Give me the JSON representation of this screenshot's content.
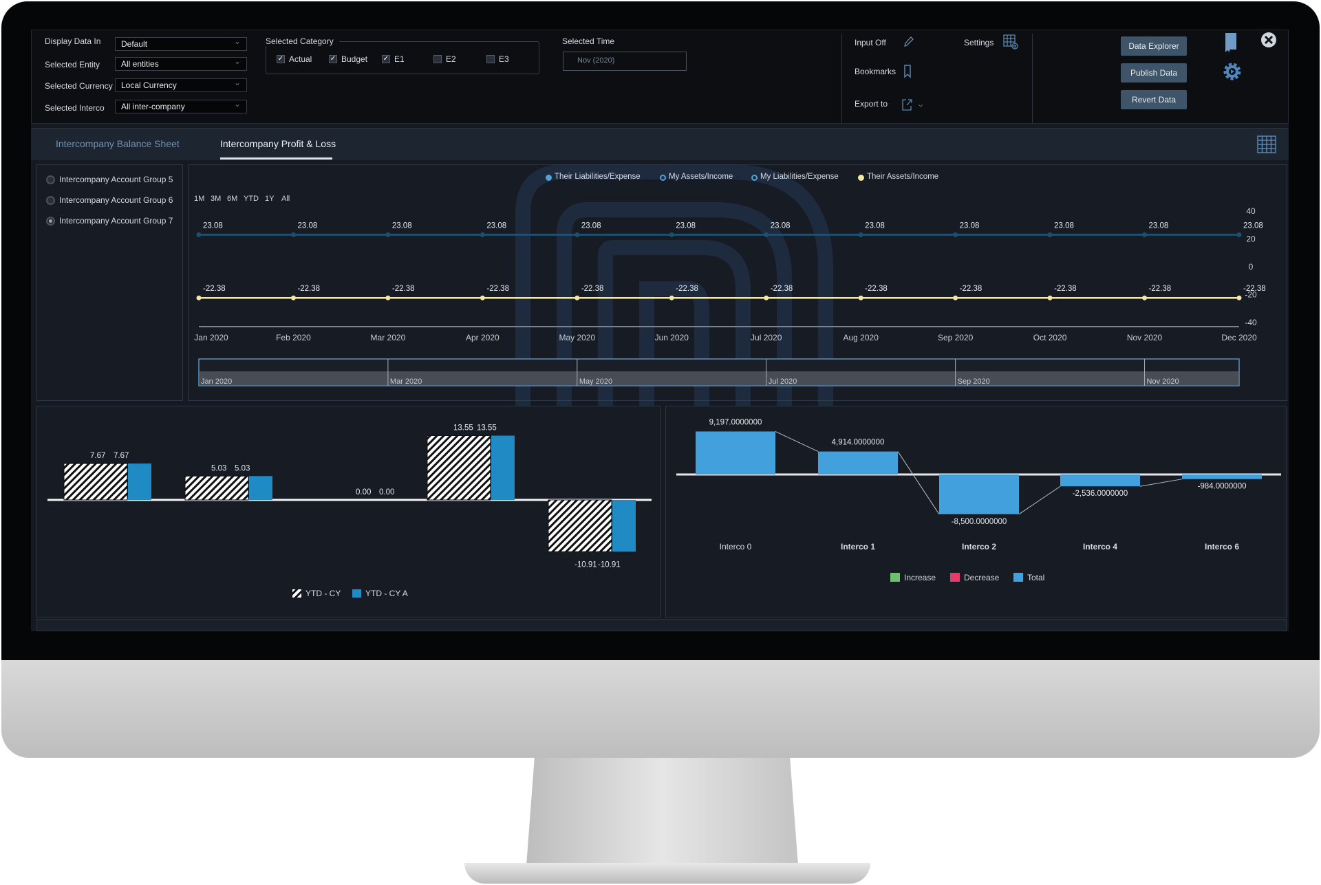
{
  "filters": {
    "display_data_in": {
      "label": "Display Data In",
      "value": "Default"
    },
    "selected_entity": {
      "label": "Selected Entity",
      "value": "All entities"
    },
    "selected_currency": {
      "label": "Selected Currency",
      "value": "Local Currency"
    },
    "selected_interco": {
      "label": "Selected Interco",
      "value": "All inter-company"
    }
  },
  "category": {
    "label": "Selected Category",
    "options": [
      {
        "label": "Actual",
        "checked": true
      },
      {
        "label": "Budget",
        "checked": true
      },
      {
        "label": "E1",
        "checked": true
      },
      {
        "label": "E2",
        "checked": false
      },
      {
        "label": "E3",
        "checked": false
      }
    ]
  },
  "time": {
    "label": "Selected Time",
    "value": "Nov (2020)"
  },
  "tools": {
    "input": "Input Off",
    "settings": "Settings",
    "bookmarks": "Bookmarks",
    "export": "Export to"
  },
  "actions": {
    "data_explorer": "Data Explorer",
    "publish": "Publish Data",
    "revert": "Revert Data"
  },
  "tabs": [
    {
      "label": "Intercompany Balance Sheet",
      "active": false
    },
    {
      "label": "Intercompany Profit & Loss",
      "active": true
    }
  ],
  "account_groups": [
    {
      "label": "Intercompany Account Group 5",
      "selected": false
    },
    {
      "label": "Intercompany Account Group 6",
      "selected": false
    },
    {
      "label": "Intercompany Account Group 7",
      "selected": true
    }
  ],
  "range_buttons": [
    "1M",
    "3M",
    "6M",
    "YTD",
    "1Y",
    "All"
  ],
  "colors": {
    "accent": "#3e5569",
    "blue_bar": "#1f8ac4",
    "waterfall_total": "#42a0dc",
    "increase": "#6cc26a",
    "decrease": "#e63c6a",
    "yellow": "#f3e7a3",
    "dark_blue_line": "#1d4f6e"
  },
  "chart_data": [
    {
      "type": "line",
      "legend": [
        {
          "name": "Their Liabilities/Expense",
          "color": "#4fa3d9"
        },
        {
          "name": "My Assets/Income",
          "color": "#4fa3d9"
        },
        {
          "name": "My Liabilities/Expense",
          "color": "#4fa3d9"
        },
        {
          "name": "Their Assets/Income",
          "color": "#f3e7a3"
        }
      ],
      "legend_placement": "top",
      "categories": [
        "Jan 2020",
        "Feb 2020",
        "Mar 2020",
        "Apr 2020",
        "May 2020",
        "Jun 2020",
        "Jul 2020",
        "Aug 2020",
        "Sep 2020",
        "Oct 2020",
        "Nov 2020",
        "Dec 2020"
      ],
      "series": [
        {
          "name": "Their Liabilities/Expense",
          "color": "#1d4f6e",
          "values": [
            23.08,
            23.08,
            23.08,
            23.08,
            23.08,
            23.08,
            23.08,
            23.08,
            23.08,
            23.08,
            23.08,
            23.08
          ]
        },
        {
          "name": "Their Assets/Income",
          "color": "#f3e7a3",
          "values": [
            -22.38,
            -22.38,
            -22.38,
            -22.38,
            -22.38,
            -22.38,
            -22.38,
            -22.38,
            -22.38,
            -22.38,
            -22.38,
            -22.38
          ]
        }
      ],
      "yticks": [
        40,
        20,
        0,
        -20,
        -40
      ],
      "ylim": [
        -40,
        40
      ],
      "y_axis": "right",
      "navigator_labels": [
        "Jan 2020",
        "Mar 2020",
        "May 2020",
        "Jul 2020",
        "Sep 2020",
        "Nov 2020"
      ]
    },
    {
      "type": "bar",
      "series": [
        {
          "name": "YTD - CY",
          "pattern": "hatched",
          "values": [
            7.67,
            5.03,
            0.0,
            13.55,
            -10.91
          ]
        },
        {
          "name": "YTD - CY A",
          "color": "#1f8ac4",
          "values": [
            7.67,
            5.03,
            0.0,
            13.55,
            -10.91
          ]
        }
      ],
      "labels": [
        [
          "7.67",
          "7.67"
        ],
        [
          "5.03",
          "5.03"
        ],
        [
          "0.00",
          "0.00"
        ],
        [
          "13.55",
          "13.55"
        ],
        [
          "-10.91",
          "-10.91"
        ]
      ],
      "legend_placement": "bottom"
    },
    {
      "type": "bar",
      "subtype": "waterfall",
      "categories": [
        "Interco 0",
        "Interco 1",
        "Interco 2",
        "Interco 4",
        "Interco 6"
      ],
      "values": [
        9197,
        4914,
        -8500,
        -2536,
        -984
      ],
      "labels": [
        "9,197.0000000",
        "4,914.0000000",
        "-8,500.0000000",
        "-2,536.0000000",
        "-984.0000000"
      ],
      "legend": [
        {
          "name": "Increase",
          "color": "#6cc26a"
        },
        {
          "name": "Decrease",
          "color": "#e63c6a"
        },
        {
          "name": "Total",
          "color": "#42a0dc"
        }
      ],
      "legend_placement": "bottom"
    }
  ]
}
